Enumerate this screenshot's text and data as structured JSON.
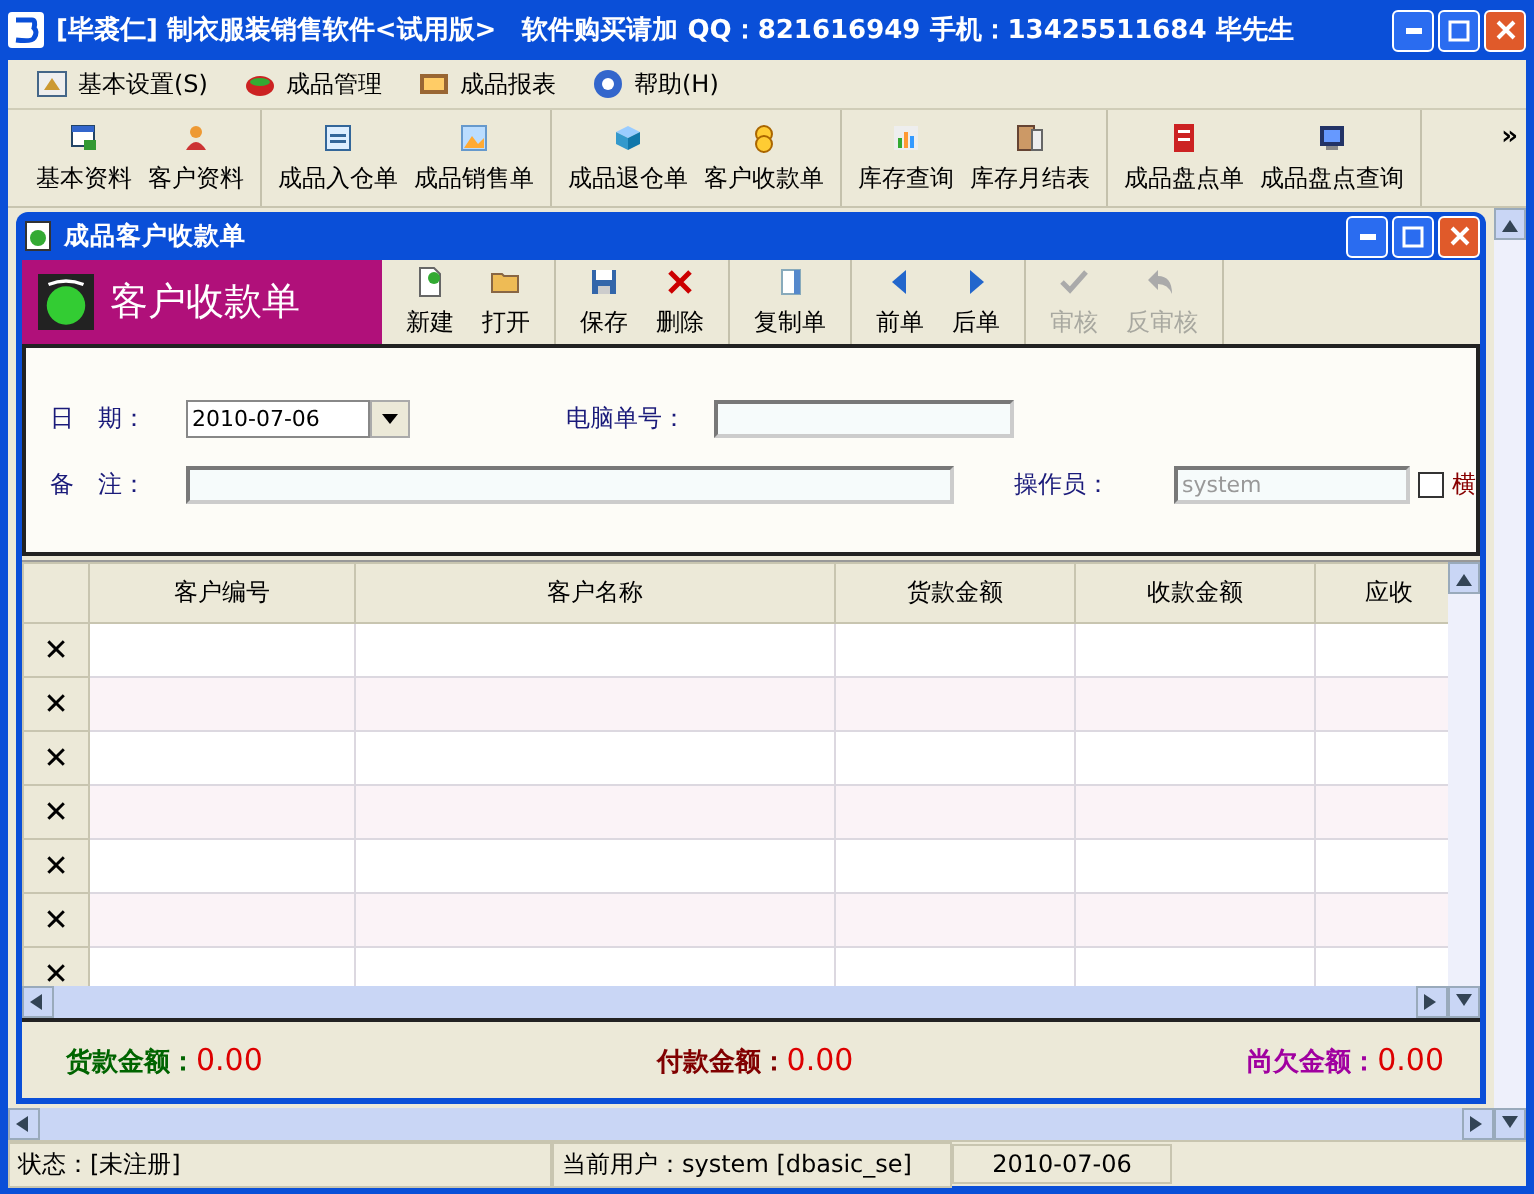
{
  "window": {
    "title": "[毕裘仁] 制衣服装销售软件<试用版>　软件购买请加 QQ：821616949 手机：13425511684 毕先生"
  },
  "menu": [
    {
      "label": "基本设置(S)"
    },
    {
      "label": "成品管理"
    },
    {
      "label": "成品报表"
    },
    {
      "label": "帮助(H)"
    }
  ],
  "toolbar": {
    "groups": [
      {
        "items": [
          {
            "label": "基本资料"
          },
          {
            "label": "客户资料"
          }
        ]
      },
      {
        "items": [
          {
            "label": "成品入仓单"
          },
          {
            "label": "成品销售单"
          }
        ]
      },
      {
        "items": [
          {
            "label": "成品退仓单"
          },
          {
            "label": "客户收款单"
          }
        ]
      },
      {
        "items": [
          {
            "label": "库存查询"
          },
          {
            "label": "库存月结表"
          }
        ]
      },
      {
        "items": [
          {
            "label": "成品盘点单"
          },
          {
            "label": "成品盘点查询"
          }
        ]
      }
    ],
    "overflow": "»"
  },
  "document": {
    "title": "成品客户收款单",
    "heading": "客户收款单",
    "toolbar": [
      {
        "items": [
          {
            "label": "新建",
            "disabled": false
          },
          {
            "label": "打开",
            "disabled": false
          }
        ]
      },
      {
        "items": [
          {
            "label": "保存",
            "disabled": false
          },
          {
            "label": "删除",
            "disabled": false
          }
        ]
      },
      {
        "items": [
          {
            "label": "复制单",
            "disabled": false
          }
        ]
      },
      {
        "items": [
          {
            "label": "前单",
            "disabled": false
          },
          {
            "label": "后单",
            "disabled": false
          }
        ]
      },
      {
        "items": [
          {
            "label": "审核",
            "disabled": true
          },
          {
            "label": "反审核",
            "disabled": true
          }
        ]
      }
    ],
    "form": {
      "date": {
        "label": "日　期：",
        "value": "2010-07-06"
      },
      "number": {
        "label": "电脑单号："
      },
      "note": {
        "label": "备　注："
      },
      "operator": {
        "label": "操作员：",
        "value": "system",
        "disabled": true
      },
      "option": {
        "label": "横",
        "checked": false
      }
    },
    "grid": {
      "columns": [
        "客户编号",
        "客户名称",
        "货款金额",
        "收款金额",
        "应收"
      ],
      "rows": [
        {
          "marker": "✕"
        },
        {
          "marker": "✕"
        },
        {
          "marker": "✕"
        },
        {
          "marker": "✕"
        },
        {
          "marker": "✕"
        },
        {
          "marker": "✕"
        },
        {
          "marker": "✕"
        }
      ]
    },
    "totals": [
      {
        "label": "货款金额：",
        "value": "0.00",
        "color": "#006400"
      },
      {
        "label": "付款金额：",
        "value": "0.00",
        "color": "#800000"
      },
      {
        "label": "尚欠金额：",
        "value": "0.00",
        "color": "#a000a0"
      }
    ]
  },
  "status_bar": [
    "状态：[未注册]",
    "当前用户：system [dbasic_se]",
    "2010-07-06"
  ]
}
